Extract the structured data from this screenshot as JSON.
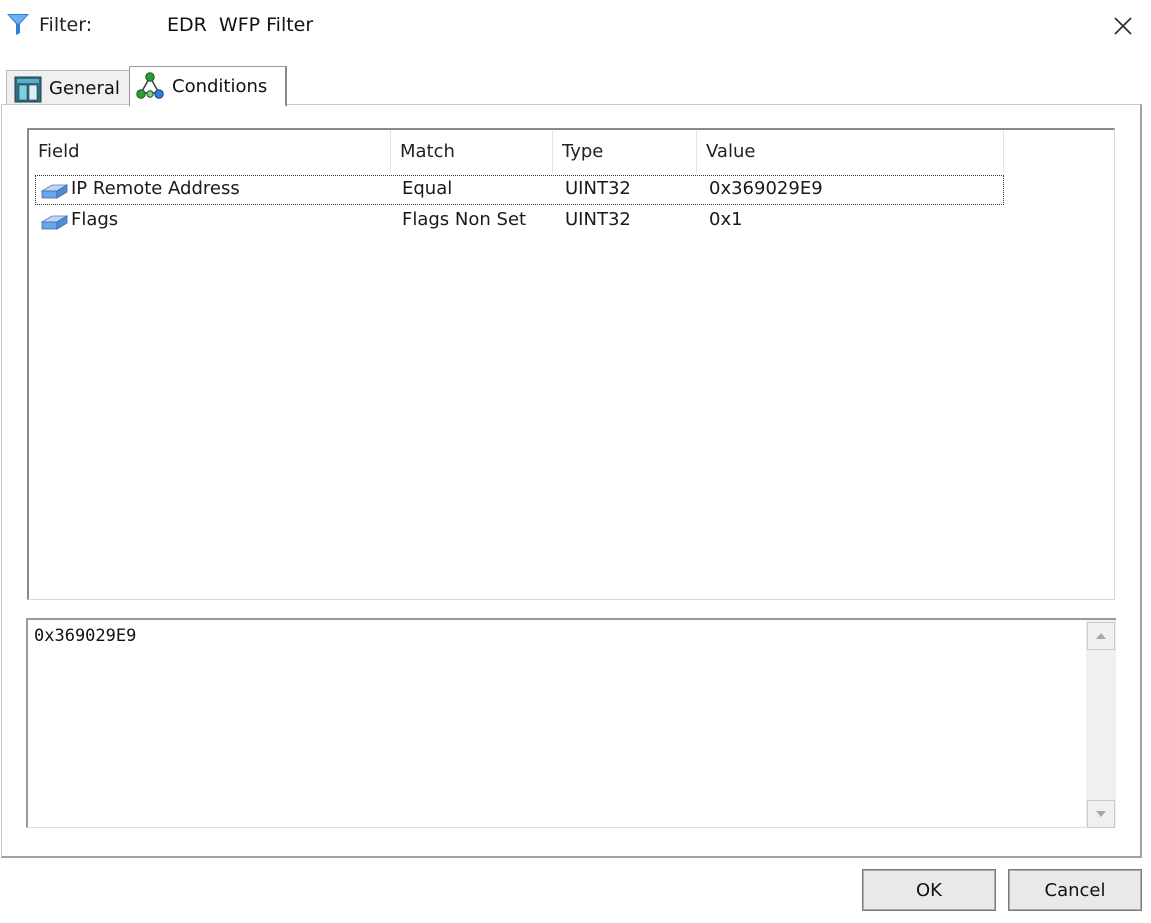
{
  "titlebar": {
    "label": "Filter:",
    "value": "EDR  WFP Filter",
    "icon": "funnel-icon",
    "close_icon": "close-icon"
  },
  "tabs": [
    {
      "label": "General",
      "icon": "general-tab-icon",
      "selected": false
    },
    {
      "label": "Conditions",
      "icon": "conditions-tab-icon",
      "selected": true
    }
  ],
  "conditions": {
    "columns": [
      "Field",
      "Match",
      "Type",
      "Value"
    ],
    "rows": [
      {
        "field": "IP Remote Address",
        "match": "Equal",
        "type": "UINT32",
        "value": "0x369029E9",
        "icon": "condition-block-icon"
      },
      {
        "field": "Flags",
        "match": "Flags Non Set",
        "type": "UINT32",
        "value": "0x1",
        "icon": "condition-block-icon"
      }
    ]
  },
  "value_box": {
    "text": "0x369029E9"
  },
  "buttons": {
    "ok": "OK",
    "cancel": "Cancel"
  },
  "colors": {
    "funnel": "#2f7fd6",
    "button_face": "#e9e9e9"
  }
}
